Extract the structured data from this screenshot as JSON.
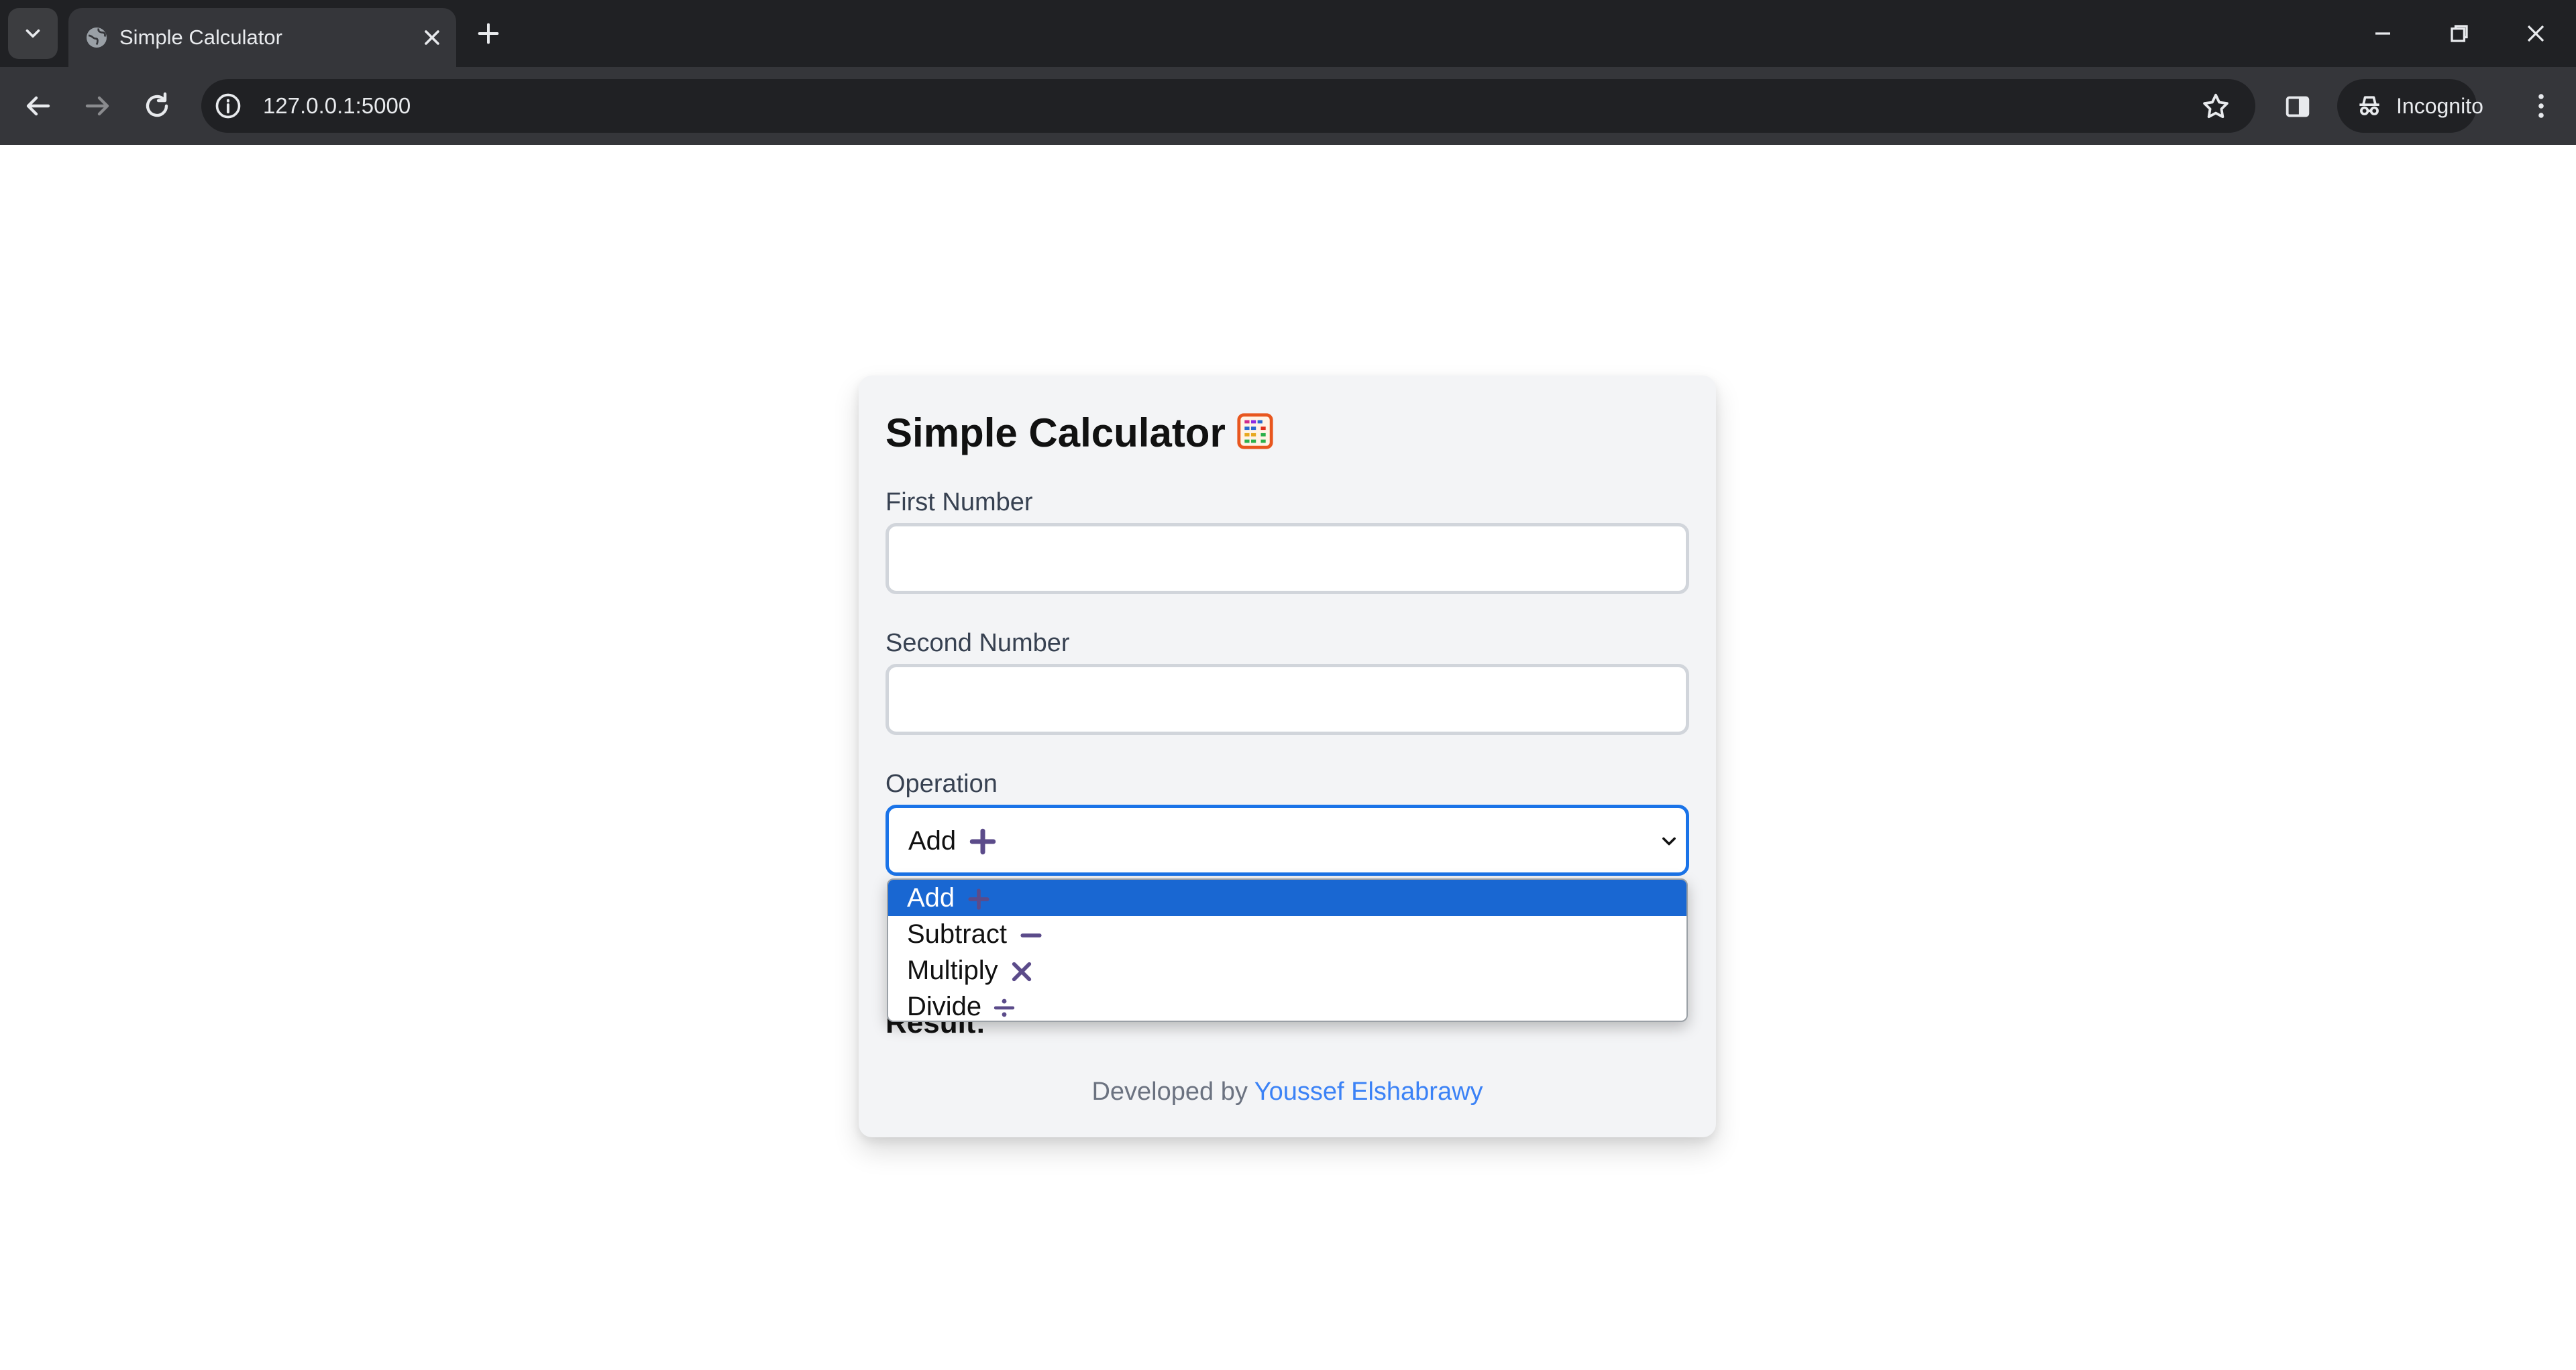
{
  "browser": {
    "tab_title": "Simple Calculator",
    "url": "127.0.0.1:5000",
    "profile_label": "Incognito"
  },
  "page": {
    "title": "Simple Calculator",
    "first_number_label": "First Number",
    "first_number_value": "",
    "second_number_label": "Second Number",
    "second_number_value": "",
    "operation_label": "Operation",
    "operation_selected": "Add",
    "operation_options": [
      {
        "label": "Add",
        "icon": "plus-icon",
        "selected": true
      },
      {
        "label": "Subtract",
        "icon": "minus-icon",
        "selected": false
      },
      {
        "label": "Multiply",
        "icon": "multiply-icon",
        "selected": false
      },
      {
        "label": "Divide",
        "icon": "divide-icon",
        "selected": false
      }
    ],
    "result_label": "Result:",
    "footer_prefix": "Developed by",
    "footer_author": "Youssef Elshabrawy"
  },
  "colors": {
    "accent": "#1a73e8",
    "highlight": "#1967d2",
    "link": "#3b82f6",
    "icon_purple": "#5b4b8a"
  }
}
